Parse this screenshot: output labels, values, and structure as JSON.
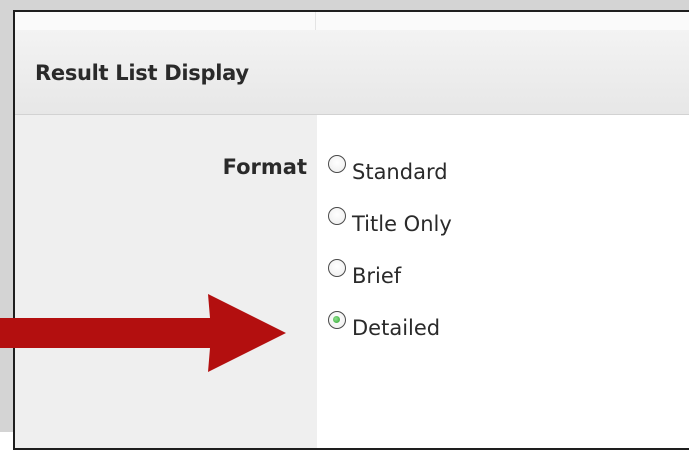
{
  "section": {
    "title": "Result List Display"
  },
  "format": {
    "label": "Format",
    "options": [
      {
        "label": "Standard",
        "checked": false
      },
      {
        "label": "Title Only",
        "checked": false
      },
      {
        "label": "Brief",
        "checked": false
      },
      {
        "label": "Detailed",
        "checked": true
      }
    ]
  },
  "colors": {
    "arrow": "#b30f0f",
    "header_bg": "#ececec",
    "label_column_bg": "#efefef",
    "radio_selected": "#2fa52f"
  },
  "icons": {
    "pointer": "arrow-right-icon"
  }
}
